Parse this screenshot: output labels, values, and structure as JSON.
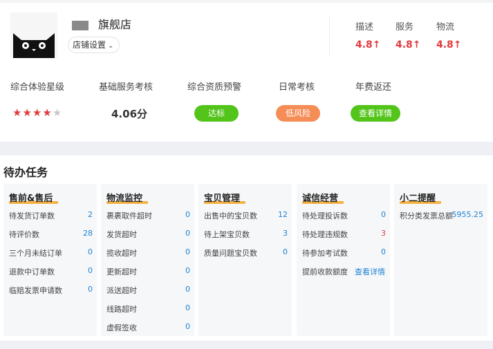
{
  "store": {
    "name": "旗舰店",
    "settings_label": "店铺设置"
  },
  "scores": [
    {
      "label": "描述",
      "value": "4.8↑"
    },
    {
      "label": "服务",
      "value": "4.8↑"
    },
    {
      "label": "物流",
      "value": "4.8↑"
    }
  ],
  "metrics": {
    "experience": {
      "label": "综合体验星级",
      "stars_filled": 4,
      "stars_total": 5
    },
    "basic_service": {
      "label": "基础服务考核",
      "value": "4.06分"
    },
    "qualification": {
      "label": "综合资质预警",
      "badge": "达标"
    },
    "daily_review": {
      "label": "日常考核",
      "badge": "低风险"
    },
    "annual_fee": {
      "label": "年费返还",
      "badge": "查看详情"
    }
  },
  "colors": {
    "score_red": "#e4393c",
    "green": "#52c41a",
    "orange": "#f58d56",
    "link_blue": "#1e82d2",
    "underline": "#f6a623"
  },
  "todo": {
    "title": "待办任务",
    "cards": [
      {
        "title": "售前&售后",
        "rows": [
          {
            "k": "待发货订单数",
            "v": "2"
          },
          {
            "k": "待评价数",
            "v": "28"
          },
          {
            "k": "三个月未结订单",
            "v": "0"
          },
          {
            "k": "退款中订单数",
            "v": "0"
          },
          {
            "k": "临赔发票申请数",
            "v": "0"
          }
        ]
      },
      {
        "title": "物流监控",
        "rows": [
          {
            "k": "裹裹取件超时",
            "v": "0"
          },
          {
            "k": "发货超时",
            "v": "0"
          },
          {
            "k": "揽收超时",
            "v": "0"
          },
          {
            "k": "更新超时",
            "v": "0"
          },
          {
            "k": "派送超时",
            "v": "0"
          },
          {
            "k": "线路超时",
            "v": "0"
          },
          {
            "k": "虚假签收",
            "v": "0"
          }
        ]
      },
      {
        "title": "宝贝管理",
        "rows": [
          {
            "k": "出售中的宝贝数",
            "v": "12"
          },
          {
            "k": "待上架宝贝数",
            "v": "3"
          },
          {
            "k": "质量问题宝贝数",
            "v": "0"
          }
        ]
      },
      {
        "title": "诚信经营",
        "rows": [
          {
            "k": "待处理投诉数",
            "v": "0"
          },
          {
            "k": "待处理违规数",
            "v": "3"
          },
          {
            "k": "待参加考试数",
            "v": "0"
          },
          {
            "k": "提前收款额度",
            "v": "查看详情"
          }
        ]
      },
      {
        "title": "小二提醒",
        "rows": [
          {
            "k": "积分类发票总额",
            "v": "5955.25"
          }
        ]
      }
    ]
  }
}
